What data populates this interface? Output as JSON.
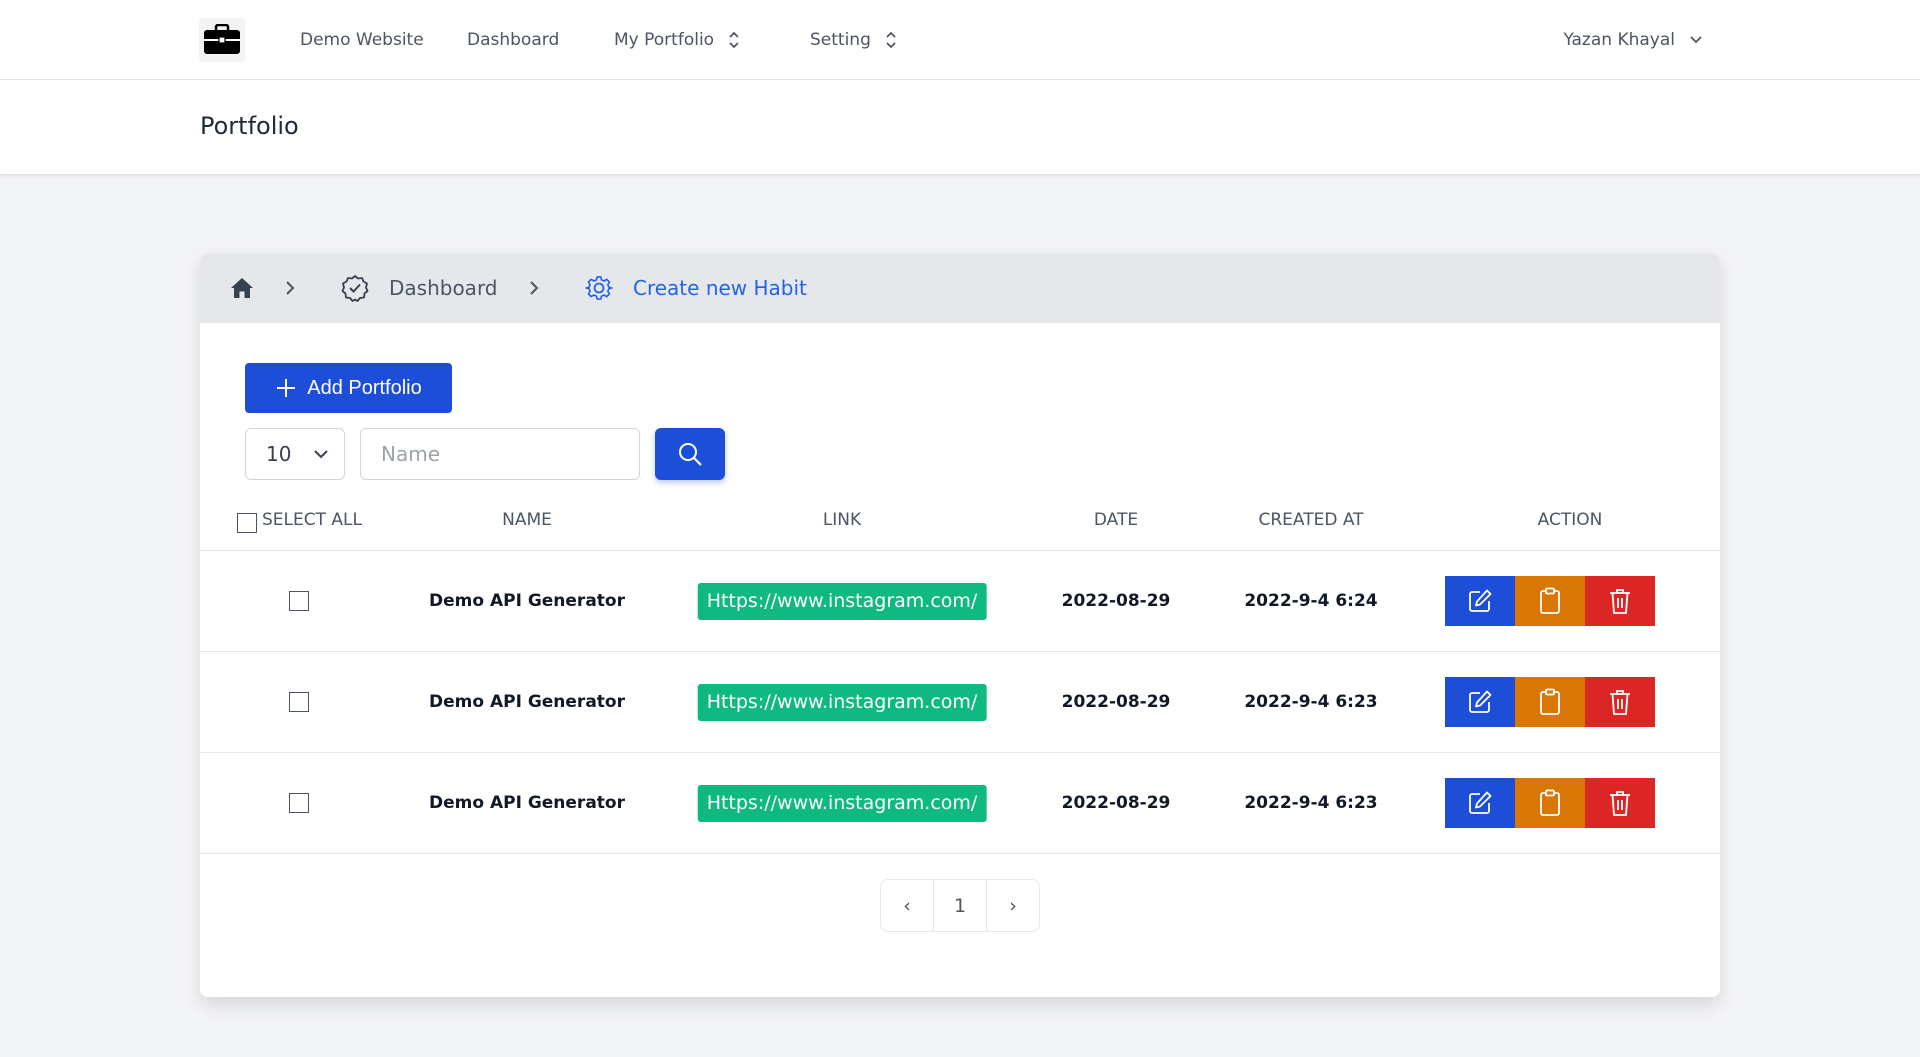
{
  "nav": {
    "logo_icon": "briefcase-icon",
    "links": [
      "Demo Website",
      "Dashboard",
      "My Portfolio",
      "Setting"
    ],
    "user": "Yazan Khayal"
  },
  "page": {
    "title": "Portfolio"
  },
  "breadcrumb": {
    "home_icon": "home-icon",
    "items": [
      "Dashboard",
      "Create new Habit"
    ],
    "active_color": "#2563eb"
  },
  "toolbar": {
    "add_label": "Add Portfolio",
    "page_size": "10",
    "search_placeholder": "Name",
    "search_value": ""
  },
  "table": {
    "select_all_label": "SELECT ALL",
    "headers": [
      "NAME",
      "LINK",
      "DATE",
      "CREATED AT",
      "ACTION"
    ],
    "rows": [
      {
        "name": "Demo API Generator",
        "link": "Https://www.instagram.com/",
        "date": "2022-08-29",
        "created_at": "2022-9-4 6:24"
      },
      {
        "name": "Demo API Generator",
        "link": "Https://www.instagram.com/",
        "date": "2022-08-29",
        "created_at": "2022-9-4 6:23"
      },
      {
        "name": "Demo API Generator",
        "link": "Https://www.instagram.com/",
        "date": "2022-08-29",
        "created_at": "2022-9-4 6:23"
      }
    ]
  },
  "pagination": {
    "prev": "‹",
    "current": "1",
    "next": "›"
  },
  "colors": {
    "primary": "#1d4ed8",
    "link_badge": "#10b981",
    "copy_action": "#d97706",
    "delete_action": "#dc2626"
  }
}
